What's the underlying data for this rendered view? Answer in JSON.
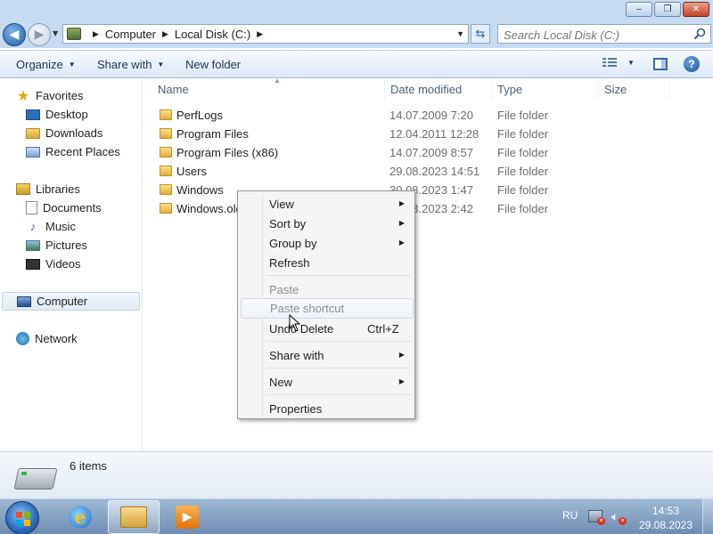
{
  "window": {
    "minimize": "‒",
    "maximize": "❐",
    "close": "✕"
  },
  "address": {
    "crumbs": [
      "Computer",
      "Local Disk (C:)"
    ],
    "search_placeholder": "Search Local Disk (C:)"
  },
  "toolbar": {
    "organize": "Organize",
    "share_with": "Share with",
    "new_folder": "New folder"
  },
  "nav": {
    "favorites": "Favorites",
    "desktop": "Desktop",
    "downloads": "Downloads",
    "recent_places": "Recent Places",
    "libraries": "Libraries",
    "documents": "Documents",
    "music": "Music",
    "pictures": "Pictures",
    "videos": "Videos",
    "computer": "Computer",
    "network": "Network"
  },
  "columns": {
    "name": "Name",
    "date_modified": "Date modified",
    "type": "Type",
    "size": "Size"
  },
  "files": [
    {
      "name": "PerfLogs",
      "date": "14.07.2009 7:20",
      "type": "File folder"
    },
    {
      "name": "Program Files",
      "date": "12.04.2011 12:28",
      "type": "File folder"
    },
    {
      "name": "Program Files (x86)",
      "date": "14.07.2009 8:57",
      "type": "File folder"
    },
    {
      "name": "Users",
      "date": "29.08.2023 14:51",
      "type": "File folder"
    },
    {
      "name": "Windows",
      "date": "30.08.2023 1:47",
      "type": "File folder"
    },
    {
      "name": "Windows.old",
      "date": "29.08.2023 2:42",
      "type": "File folder"
    }
  ],
  "context_menu": {
    "view": "View",
    "sort_by": "Sort by",
    "group_by": "Group by",
    "refresh": "Refresh",
    "paste": "Paste",
    "paste_shortcut": "Paste shortcut",
    "undo_delete": "Undo Delete",
    "undo_shortcut": "Ctrl+Z",
    "share_with": "Share with",
    "new": "New",
    "properties": "Properties"
  },
  "details": {
    "item_count": "6 items"
  },
  "taskbar": {
    "language": "RU",
    "time": "14:53",
    "date": "29.08.2023"
  }
}
